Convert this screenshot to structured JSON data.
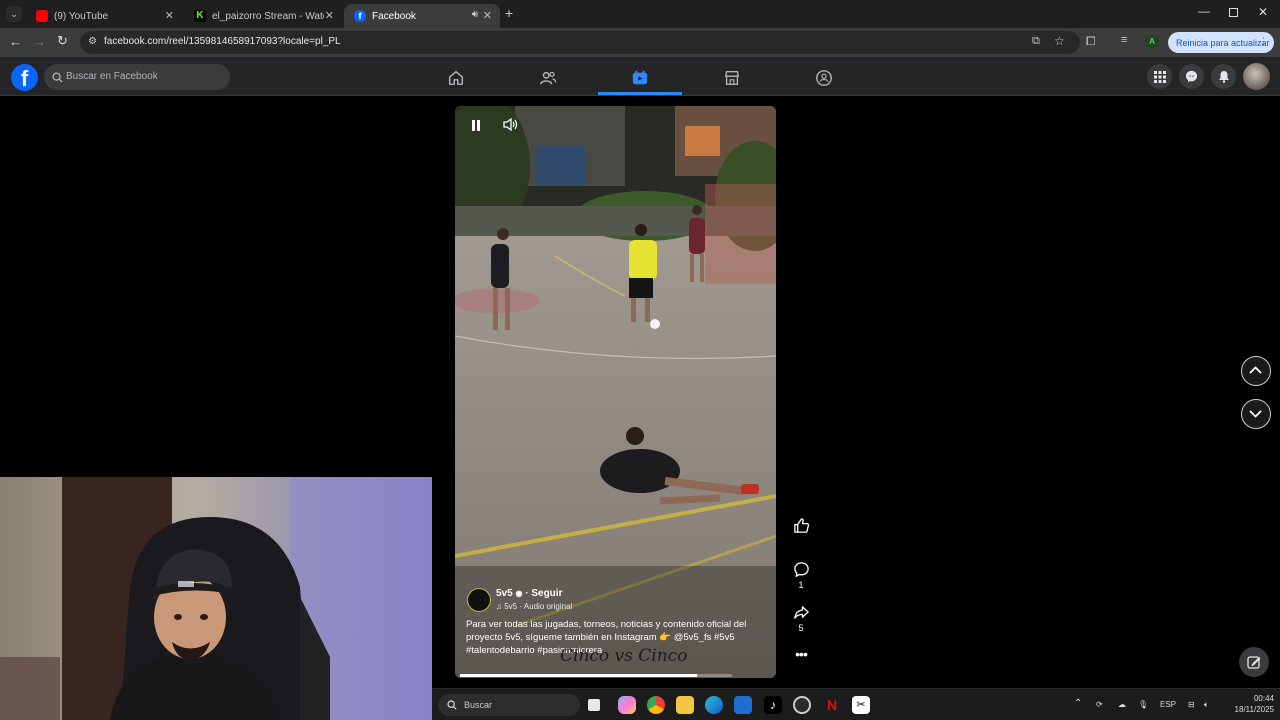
{
  "browser": {
    "tabs": [
      {
        "label": "(9) YouTube",
        "favicon_color": "#ff0000"
      },
      {
        "label": "el_paizorro Stream - Watch Live",
        "favicon_color": "#53fc18"
      },
      {
        "label": "Facebook",
        "favicon_color": "#0866ff",
        "active": true
      }
    ],
    "url": "facebook.com/reel/1359814658917093?locale=pl_PL",
    "update_button": "Reinicia para actualizar",
    "profile_initial": "A"
  },
  "facebook": {
    "search_placeholder": "Buscar en Facebook",
    "logo_glyph": "f",
    "accent_color": "#2d88ff"
  },
  "reel": {
    "author": "5v5",
    "follow": "· Seguir",
    "audio": "5v5 · Audio original",
    "caption": "Para ver todas las jugadas, torneos, noticias y contenido oficial del proyecto 5v5, sígueme también en Instagram 👉 @5v5_fs #5v5 #talentodebarrio #pasionmicrera",
    "watermark": "Cinco vs Cinco",
    "progress": 0.87,
    "comment_count": "1",
    "share_count": "5"
  },
  "taskbar": {
    "search_placeholder": "Buscar",
    "lang": "ESP",
    "time": "00:44",
    "date": "18/11/2025"
  }
}
